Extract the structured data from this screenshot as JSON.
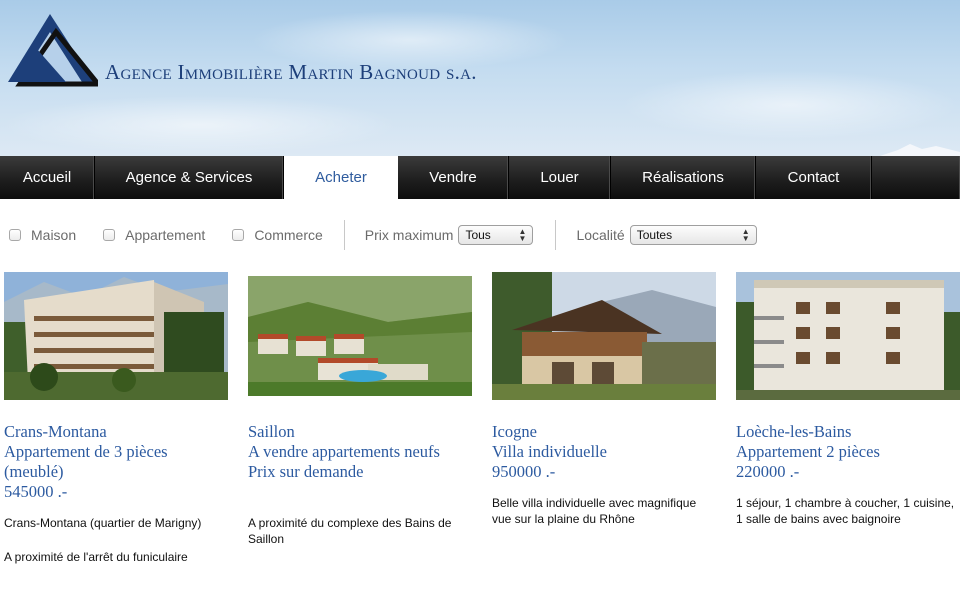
{
  "brand": {
    "name": "Agence Immobilière Martin Bagnoud s.a.",
    "colors": {
      "primary": "#1d3f7a",
      "link": "#2c5aa0",
      "nav_bg": "#1f1f1f"
    }
  },
  "nav": {
    "items": [
      {
        "label": "Accueil"
      },
      {
        "label": "Agence & Services"
      },
      {
        "label": "Acheter",
        "active": true
      },
      {
        "label": "Vendre"
      },
      {
        "label": "Louer"
      },
      {
        "label": "Réalisations"
      },
      {
        "label": "Contact"
      }
    ]
  },
  "filters": {
    "types": [
      "Maison",
      "Appartement",
      "Commerce"
    ],
    "price_label": "Prix maximum",
    "price_value": "Tous",
    "location_label": "Localité",
    "location_value": "Toutes"
  },
  "listings": [
    {
      "place": "Crans-Montana",
      "title_lines": [
        "Appartement de 3 pièces",
        "(meublé)"
      ],
      "price": "545000 .-",
      "desc": [
        "Crans-Montana (quartier de Marigny)",
        "A proximité de l'arrêt du funiculaire"
      ]
    },
    {
      "place": "Saillon",
      "title_lines": [
        "A vendre appartements neufs",
        "Prix sur demande"
      ],
      "price": "",
      "desc": [
        "A proximité du complexe des Bains de Saillon"
      ]
    },
    {
      "place": "Icogne",
      "title_lines": [
        "Villa individuelle"
      ],
      "price": "950000 .-",
      "desc": [
        "Belle villa individuelle avec magnifique vue sur la plaine du Rhône"
      ]
    },
    {
      "place": "Loèche-les-Bains",
      "title_lines": [
        "Appartement 2 pièces"
      ],
      "price": "220000 .-",
      "desc": [
        "1 séjour, 1 chambre à coucher, 1 cuisine, 1 salle de bains avec baignoire"
      ]
    }
  ]
}
